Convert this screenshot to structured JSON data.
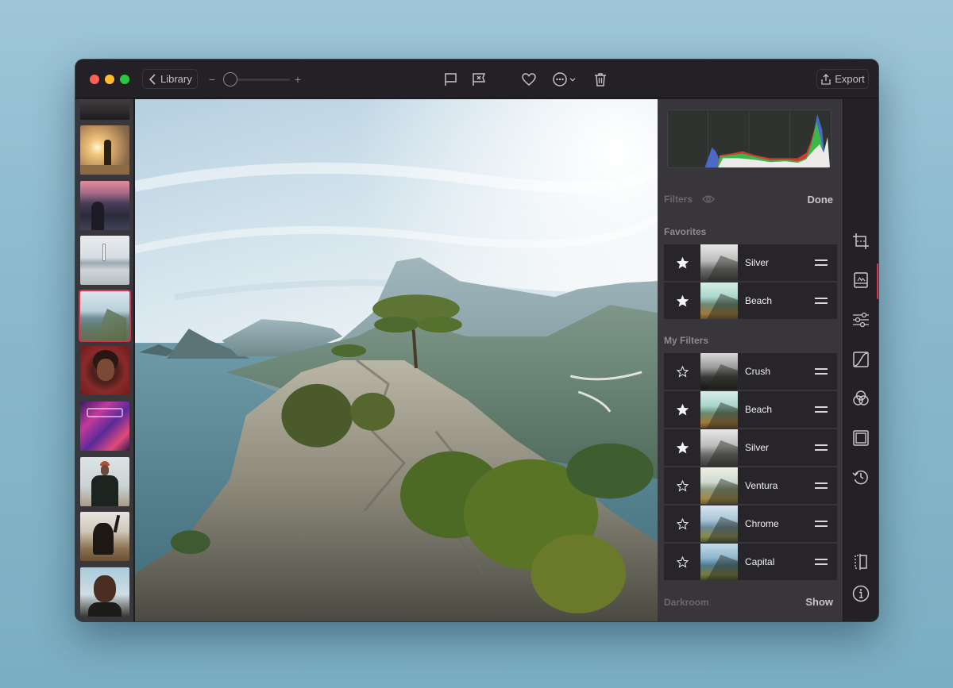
{
  "window": {
    "toolbar": {
      "back_label": "Library",
      "zoom_level": 0.05,
      "export_label": "Export",
      "icons": [
        "flag-icon",
        "reject-flag-icon",
        "heart-icon",
        "more-options-icon",
        "chevron-down-icon",
        "trash-icon"
      ]
    },
    "filmstrip": {
      "thumbnails": [
        {
          "name": "dark-strip"
        },
        {
          "name": "sunset-silhouette"
        },
        {
          "name": "city-evening-street"
        },
        {
          "name": "lighthouse-pier"
        },
        {
          "name": "coastal-mountain",
          "selected": true
        },
        {
          "name": "portrait-curly-hair"
        },
        {
          "name": "neon-sign-portrait"
        },
        {
          "name": "man-black-turtleneck"
        },
        {
          "name": "dancing-silhouette"
        },
        {
          "name": "portrait-hand-over-face"
        }
      ]
    },
    "panel": {
      "filters_label": "Filters",
      "done_label": "Done",
      "favorites_label": "Favorites",
      "favorites": [
        {
          "name": "Silver",
          "starred": true,
          "tone": "mono"
        },
        {
          "name": "Beach",
          "starred": true,
          "tone": "warm"
        }
      ],
      "my_filters_label": "My Filters",
      "my_filters": [
        {
          "name": "Crush",
          "starred": false,
          "tone": "mono-dark"
        },
        {
          "name": "Beach",
          "starred": true,
          "tone": "warm"
        },
        {
          "name": "Silver",
          "starred": true,
          "tone": "mono"
        },
        {
          "name": "Ventura",
          "starred": false,
          "tone": "warm-light"
        },
        {
          "name": "Chrome",
          "starred": false,
          "tone": "cool"
        },
        {
          "name": "Capital",
          "starred": false,
          "tone": "cool-deep"
        }
      ],
      "darkroom_label": "Darkroom",
      "show_label": "Show"
    },
    "rail": {
      "tools": [
        "crop-icon",
        "filters-icon",
        "adjust-sliders-icon",
        "curves-icon",
        "color-mixer-icon",
        "frame-icon",
        "history-icon"
      ],
      "bottom": [
        "compare-icon",
        "info-icon"
      ],
      "active_tool": "filters-icon"
    },
    "colors": {
      "accent": "#d8334f",
      "window_bg": "#232126",
      "panel_bg": "#39363b",
      "row_bg": "#272529"
    }
  }
}
